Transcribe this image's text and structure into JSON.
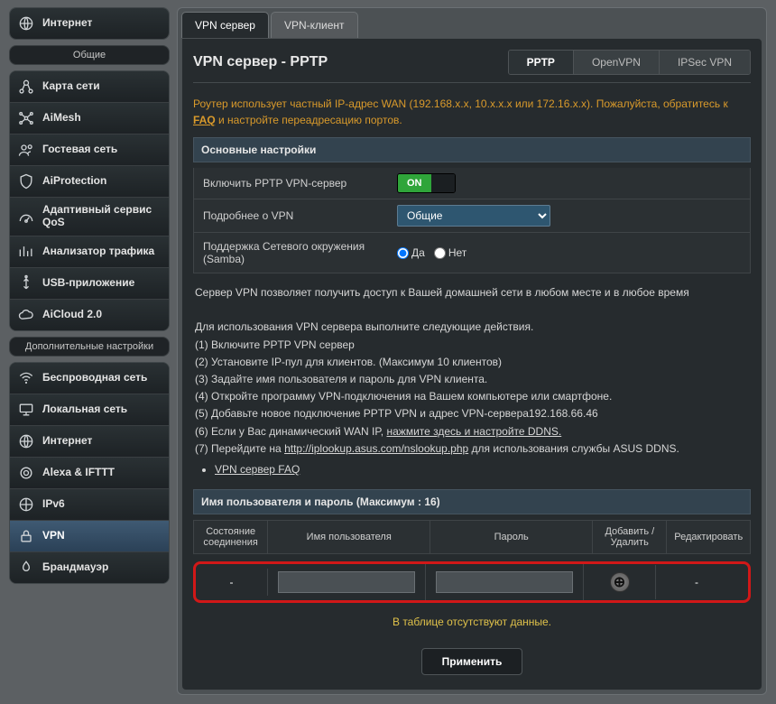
{
  "sidebar": {
    "internet_top": "Интернет",
    "general_title": "Общие",
    "general": [
      {
        "label": "Карта сети"
      },
      {
        "label": "AiMesh"
      },
      {
        "label": "Гостевая сеть"
      },
      {
        "label": "AiProtection"
      },
      {
        "label": "Адаптивный сервис QoS"
      },
      {
        "label": "Анализатор трафика"
      },
      {
        "label": "USB-приложение"
      },
      {
        "label": "AiCloud 2.0"
      }
    ],
    "advanced_title": "Дополнительные настройки",
    "advanced": [
      {
        "label": "Беспроводная сеть"
      },
      {
        "label": "Локальная сеть"
      },
      {
        "label": "Интернет"
      },
      {
        "label": "Alexa & IFTTT"
      },
      {
        "label": "IPv6"
      },
      {
        "label": "VPN"
      },
      {
        "label": "Брандмауэр"
      }
    ],
    "active": "VPN"
  },
  "tabs": {
    "server": "VPN сервер",
    "client": "VPN-клиент"
  },
  "page": {
    "title": "VPN сервер - PPTP",
    "proto": {
      "pptp": "PPTP",
      "openvpn": "OpenVPN",
      "ipsec": "IPSec VPN"
    },
    "warn_pre": "Роутер использует частный IP-адрес WAN (192.168.x.x, 10.x.x.x или 172.16.x.x). Пожалуйста, обратитесь к ",
    "warn_link": "FAQ",
    "warn_post": " и настройте переадресацию портов.",
    "basic_title": "Основные настройки",
    "rows": {
      "enable": "Включить PPTP VPN-сервер",
      "on": "ON",
      "more": "Подробнее о VPN",
      "more_select": "Общие",
      "samba": "Поддержка Сетевого окружения (Samba)",
      "yes": "Да",
      "no": "Нет"
    },
    "desc": {
      "p1": "Сервер VPN позволяет получить доступ к Вашей домашней сети в любом месте и в любое время",
      "p2": "Для использования VPN сервера выполните следующие действия.",
      "s1": "(1) Включите PPTP VPN сервер",
      "s2": "(2) Установите IP-пул для клиентов. (Максимум 10 клиентов)",
      "s3": "(3) Задайте имя пользователя и пароль для VPN клиента.",
      "s4": "(4) Откройте программу VPN-подключения на Вашем компьютере или смартфоне.",
      "s5": "(5) Добавьте новое подключение PPTP VPN и адрес VPN-сервера192.168.66.46",
      "s6_pre": "(6) Если у Вас динамический WAN IP, ",
      "s6_link": "нажмите здесь и настройте DDNS.",
      "s7_pre": "(7) Перейдите на ",
      "s7_link": "http://iplookup.asus.com/nslookup.php",
      "s7_post": " для использования службы ASUS DDNS.",
      "faq": "VPN сервер FAQ"
    },
    "users": {
      "title": "Имя пользователя и пароль (Максимум : 16)",
      "th_status": "Состояние соединения",
      "th_user": "Имя пользователя",
      "th_pass": "Пароль",
      "th_add": "Добавить / Удалить",
      "th_edit": "Редактировать",
      "dash": "-",
      "nodata": "В таблице отсутствуют данные."
    },
    "apply": "Применить"
  }
}
